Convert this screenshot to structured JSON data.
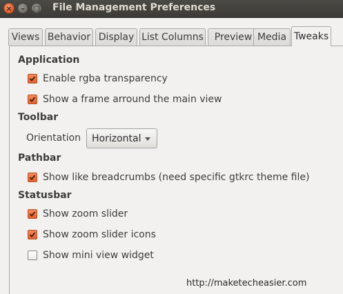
{
  "window": {
    "title": "File Management Preferences",
    "close_glyph": "×",
    "minimize_glyph": "–",
    "maximize_glyph": "□"
  },
  "tabs": [
    {
      "label": "Views",
      "active": false
    },
    {
      "label": "Behavior",
      "active": false
    },
    {
      "label": "Display",
      "active": false
    },
    {
      "label": "List Columns",
      "active": false
    },
    {
      "label": "Preview",
      "active": false
    },
    {
      "label": "Media",
      "active": false
    },
    {
      "label": "Tweaks",
      "active": true
    }
  ],
  "sections": {
    "application": {
      "heading": "Application",
      "options": [
        {
          "label": "Enable rgba transparency",
          "checked": true
        },
        {
          "label": "Show a frame arround the main view",
          "checked": true
        }
      ]
    },
    "toolbar": {
      "heading": "Toolbar",
      "orientation_label": "Orientation",
      "orientation_value": "Horizontal"
    },
    "pathbar": {
      "heading": "Pathbar",
      "options": [
        {
          "label": "Show like breadcrumbs (need specific gtkrc theme file)",
          "checked": true
        }
      ]
    },
    "statusbar": {
      "heading": "Statusbar",
      "options": [
        {
          "label": "Show zoom slider",
          "checked": true
        },
        {
          "label": "Show zoom slider icons",
          "checked": true
        },
        {
          "label": "Show mini view widget",
          "checked": false
        }
      ]
    }
  },
  "watermark": "http://maketecheasier.com",
  "colors": {
    "titlebar": "#3c3b37",
    "title_text": "#dfdbd2",
    "accent_checkbox": "#e4602d",
    "window_bg": "#f2f1f0"
  }
}
